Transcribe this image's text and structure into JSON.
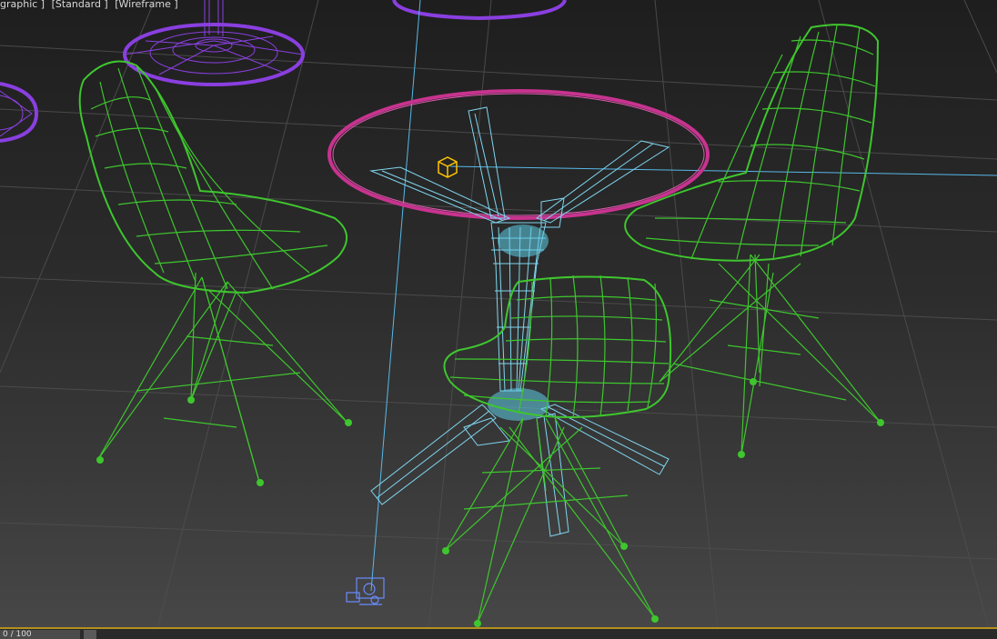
{
  "viewport": {
    "labels": [
      "graphic ]",
      "[Standard ]",
      "[Wireframe ]"
    ]
  },
  "colors": {
    "chair": "#3ec62e",
    "table_base": "#7fd6f0",
    "table_top": "#c8338f",
    "background_objects": "#8a3fe0",
    "grid": "#4e4e4e",
    "selection_line": "#58b8e8",
    "helper": "#ffc400",
    "timeline_accent": "#b3901f"
  },
  "icons": {
    "helper": "point-helper-icon",
    "camera": "camera-icon"
  },
  "timeline": {
    "frame": "0 / 100"
  }
}
